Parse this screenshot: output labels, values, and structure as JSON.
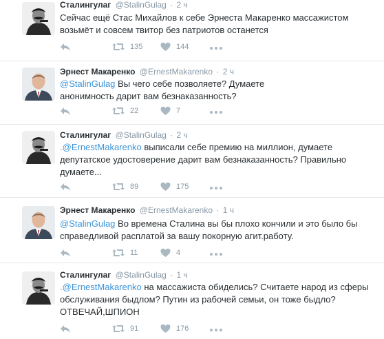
{
  "tweets": [
    {
      "name": "Сталингулаг",
      "handle": "@StalinGulag",
      "sep": "·",
      "time": "2 ч",
      "avatar": "stalin-avatar",
      "text_plain": "Сейчас ещё Стас Михайлов к себе Эрнеста Макаренко массажистом возьмёт и совсем твитор без патриотов останется",
      "retweets": "135",
      "likes": "144"
    },
    {
      "name": "Эрнест Макаренко",
      "handle": "@ErnestMakarenko",
      "sep": "·",
      "time": "2 ч",
      "avatar": "makarenko-avatar",
      "mention": "@StalinGulag",
      "text_after": " Вы чего себе позволяете? Думаете анонимность дарит вам безнаказанность?",
      "retweets": "22",
      "likes": "7"
    },
    {
      "name": "Сталингулаг",
      "handle": "@StalinGulag",
      "sep": "·",
      "time": "2 ч",
      "avatar": "stalin-avatar",
      "prefix": ".",
      "mention": "@ErnestMakarenko",
      "text_after": " выписали себе премию на миллион, думаете депутатское удостоверение дарит вам безнаказанность? Правильно думаете...",
      "retweets": "89",
      "likes": "175"
    },
    {
      "name": "Эрнест Макаренко",
      "handle": "@ErnestMakarenko",
      "sep": "·",
      "time": "1 ч",
      "avatar": "makarenko-avatar",
      "mention": "@StalinGulag",
      "text_after": " Во времена Сталина вы бы плохо кончили и это было бы справедливой расплатой за вашу покорную агит.работу.",
      "retweets": "11",
      "likes": "4"
    },
    {
      "name": "Сталингулаг",
      "handle": "@StalinGulag",
      "sep": "·",
      "time": "1 ч",
      "avatar": "stalin-avatar",
      "prefix": ".",
      "mention": "@ErnestMakarenko",
      "text_after": " на массажиста обиделись? Считаете народ из сферы обслуживания быдлом? Путин из рабочей семьи, он тоже быдло? ОТВЕЧАЙ,ШПИОН",
      "retweets": "91",
      "likes": "176"
    }
  ],
  "icons": {
    "reply": "reply-icon",
    "retweet": "retweet-icon",
    "like": "heart-icon",
    "more": "more-icon"
  },
  "colors": {
    "link": "#3b94d9",
    "meta": "#8899a6",
    "text": "#292f33",
    "divider": "#e1e8ed"
  }
}
